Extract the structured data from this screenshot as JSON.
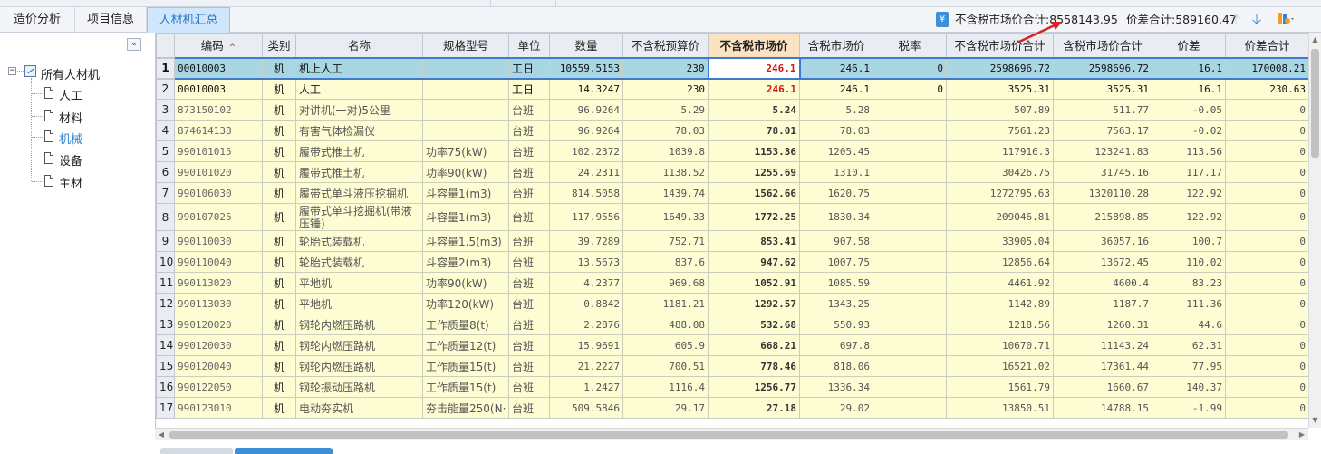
{
  "tabs": [
    {
      "label": "造价分析",
      "active": false
    },
    {
      "label": "项目信息",
      "active": false
    },
    {
      "label": "人材机汇总",
      "active": true
    }
  ],
  "summary": {
    "excl_tax_market_total_label": "不含税市场价合计",
    "excl_tax_market_total_value": "8558143.95",
    "price_diff_total_label": "价差合计",
    "price_diff_total_value": "589160.47",
    "separator": ":"
  },
  "tree": {
    "root": "所有人材机",
    "children": [
      "人工",
      "材料",
      "机械",
      "设备",
      "主材"
    ],
    "selected": "机械"
  },
  "columns": [
    "编码",
    "类别",
    "名称",
    "规格型号",
    "单位",
    "数量",
    "不含税预算价",
    "不含税市场价",
    "含税市场价",
    "税率",
    "不含税市场价合计",
    "含税市场价合计",
    "价差",
    "价差合计"
  ],
  "sorted_column": "编码",
  "active_column": "不含税市场价",
  "rows": [
    {
      "n": "1",
      "code": "00010003",
      "type": "机",
      "name": "机上人工",
      "spec": "",
      "unit": "工日",
      "qty": "10559.5153",
      "budget": "230",
      "market": "246.1",
      "market_tax": "246.1",
      "rate": "0",
      "market_total": "2598696.72",
      "market_tax_total": "2598696.72",
      "diff": "16.1",
      "diff_total": "170008.21"
    },
    {
      "n": "2",
      "code": "00010003",
      "type": "机",
      "name": "人工",
      "spec": "",
      "unit": "工日",
      "qty": "14.3247",
      "budget": "230",
      "market": "246.1",
      "market_tax": "246.1",
      "rate": "0",
      "market_total": "3525.31",
      "market_tax_total": "3525.31",
      "diff": "16.1",
      "diff_total": "230.63"
    },
    {
      "n": "3",
      "code": "873150102",
      "type": "机",
      "name": "对讲机(一对)5公里",
      "spec": "",
      "unit": "台班",
      "qty": "96.9264",
      "budget": "5.29",
      "market": "5.24",
      "market_tax": "5.28",
      "rate": "",
      "market_total": "507.89",
      "market_tax_total": "511.77",
      "diff": "-0.05",
      "diff_total": "0"
    },
    {
      "n": "4",
      "code": "874614138",
      "type": "机",
      "name": "有害气体检漏仪",
      "spec": "",
      "unit": "台班",
      "qty": "96.9264",
      "budget": "78.03",
      "market": "78.01",
      "market_tax": "78.03",
      "rate": "",
      "market_total": "7561.23",
      "market_tax_total": "7563.17",
      "diff": "-0.02",
      "diff_total": "0"
    },
    {
      "n": "5",
      "code": "990101015",
      "type": "机",
      "name": "履带式推土机",
      "spec": "功率75(kW)",
      "unit": "台班",
      "qty": "102.2372",
      "budget": "1039.8",
      "market": "1153.36",
      "market_tax": "1205.45",
      "rate": "",
      "market_total": "117916.3",
      "market_tax_total": "123241.83",
      "diff": "113.56",
      "diff_total": "0"
    },
    {
      "n": "6",
      "code": "990101020",
      "type": "机",
      "name": "履带式推土机",
      "spec": "功率90(kW)",
      "unit": "台班",
      "qty": "24.2311",
      "budget": "1138.52",
      "market": "1255.69",
      "market_tax": "1310.1",
      "rate": "",
      "market_total": "30426.75",
      "market_tax_total": "31745.16",
      "diff": "117.17",
      "diff_total": "0"
    },
    {
      "n": "7",
      "code": "990106030",
      "type": "机",
      "name": "履带式单斗液压挖掘机",
      "spec": "斗容量1(m3)",
      "unit": "台班",
      "qty": "814.5058",
      "budget": "1439.74",
      "market": "1562.66",
      "market_tax": "1620.75",
      "rate": "",
      "market_total": "1272795.63",
      "market_tax_total": "1320110.28",
      "diff": "122.92",
      "diff_total": "0"
    },
    {
      "n": "8",
      "code": "990107025",
      "type": "机",
      "name": "履带式单斗挖掘机(带液压锤)",
      "spec": "斗容量1(m3)",
      "unit": "台班",
      "qty": "117.9556",
      "budget": "1649.33",
      "market": "1772.25",
      "market_tax": "1830.34",
      "rate": "",
      "market_total": "209046.81",
      "market_tax_total": "215898.85",
      "diff": "122.92",
      "diff_total": "0",
      "tall": true
    },
    {
      "n": "9",
      "code": "990110030",
      "type": "机",
      "name": "轮胎式装载机",
      "spec": "斗容量1.5(m3)",
      "unit": "台班",
      "qty": "39.7289",
      "budget": "752.71",
      "market": "853.41",
      "market_tax": "907.58",
      "rate": "",
      "market_total": "33905.04",
      "market_tax_total": "36057.16",
      "diff": "100.7",
      "diff_total": "0"
    },
    {
      "n": "10",
      "code": "990110040",
      "type": "机",
      "name": "轮胎式装载机",
      "spec": "斗容量2(m3)",
      "unit": "台班",
      "qty": "13.5673",
      "budget": "837.6",
      "market": "947.62",
      "market_tax": "1007.75",
      "rate": "",
      "market_total": "12856.64",
      "market_tax_total": "13672.45",
      "diff": "110.02",
      "diff_total": "0"
    },
    {
      "n": "11",
      "code": "990113020",
      "type": "机",
      "name": "平地机",
      "spec": "功率90(kW)",
      "unit": "台班",
      "qty": "4.2377",
      "budget": "969.68",
      "market": "1052.91",
      "market_tax": "1085.59",
      "rate": "",
      "market_total": "4461.92",
      "market_tax_total": "4600.4",
      "diff": "83.23",
      "diff_total": "0"
    },
    {
      "n": "12",
      "code": "990113030",
      "type": "机",
      "name": "平地机",
      "spec": "功率120(kW)",
      "unit": "台班",
      "qty": "0.8842",
      "budget": "1181.21",
      "market": "1292.57",
      "market_tax": "1343.25",
      "rate": "",
      "market_total": "1142.89",
      "market_tax_total": "1187.7",
      "diff": "111.36",
      "diff_total": "0"
    },
    {
      "n": "13",
      "code": "990120020",
      "type": "机",
      "name": "钢轮内燃压路机",
      "spec": "工作质量8(t)",
      "unit": "台班",
      "qty": "2.2876",
      "budget": "488.08",
      "market": "532.68",
      "market_tax": "550.93",
      "rate": "",
      "market_total": "1218.56",
      "market_tax_total": "1260.31",
      "diff": "44.6",
      "diff_total": "0"
    },
    {
      "n": "14",
      "code": "990120030",
      "type": "机",
      "name": "钢轮内燃压路机",
      "spec": "工作质量12(t)",
      "unit": "台班",
      "qty": "15.9691",
      "budget": "605.9",
      "market": "668.21",
      "market_tax": "697.8",
      "rate": "",
      "market_total": "10670.71",
      "market_tax_total": "11143.24",
      "diff": "62.31",
      "diff_total": "0"
    },
    {
      "n": "15",
      "code": "990120040",
      "type": "机",
      "name": "钢轮内燃压路机",
      "spec": "工作质量15(t)",
      "unit": "台班",
      "qty": "21.2227",
      "budget": "700.51",
      "market": "778.46",
      "market_tax": "818.06",
      "rate": "",
      "market_total": "16521.02",
      "market_tax_total": "17361.44",
      "diff": "77.95",
      "diff_total": "0"
    },
    {
      "n": "16",
      "code": "990122050",
      "type": "机",
      "name": "钢轮振动压路机",
      "spec": "工作质量15(t)",
      "unit": "台班",
      "qty": "1.2427",
      "budget": "1116.4",
      "market": "1256.77",
      "market_tax": "1336.34",
      "rate": "",
      "market_total": "1561.79",
      "market_tax_total": "1660.67",
      "diff": "140.37",
      "diff_total": "0"
    },
    {
      "n": "17",
      "code": "990123010",
      "type": "机",
      "name": "电动夯实机",
      "spec": "夯击能量250(N·",
      "unit": "台班",
      "qty": "509.5846",
      "budget": "29.17",
      "market": "27.18",
      "market_tax": "29.02",
      "rate": "",
      "market_total": "13850.51",
      "market_tax_total": "14788.15",
      "diff": "-1.99",
      "diff_total": "0"
    }
  ],
  "colors": {
    "row_bg": "#fefcd2",
    "selected_row_bg": "#a9d6e3",
    "active_header_bg": "#fbe3c2",
    "market_price_red": "#d11515",
    "tab_active_text": "#2a78c8",
    "annotation_arrow": "#e02020"
  },
  "icons": {
    "summary": "calculator-icon",
    "move_up": "arrow-up-icon",
    "move_down": "arrow-down-icon",
    "tool": "settings-dropdown-icon",
    "collapse": "double-chevron-left-icon",
    "tree_root": "folder-chart-icon",
    "tree_leaf": "document-icon"
  }
}
